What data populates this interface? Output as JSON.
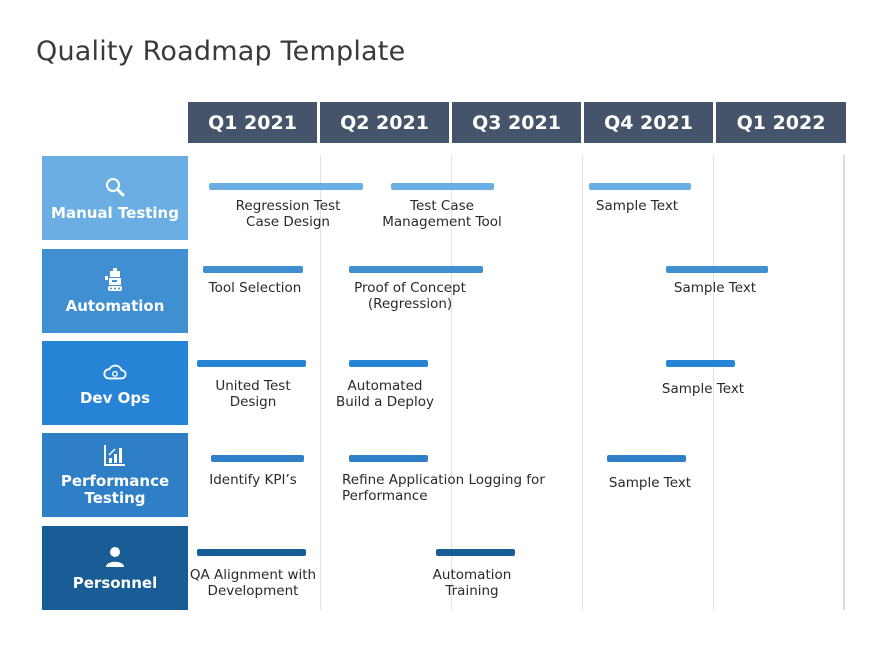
{
  "title": "Quality Roadmap Template",
  "quarters": [
    "Q1 2021",
    "Q2 2021",
    "Q3 2021",
    "Q4 2021",
    "Q1 2022"
  ],
  "colors": {
    "header_bg": "#46546b",
    "manual_testing": "#6aaee3",
    "automation": "#3f8fd2",
    "dev_ops": "#2683d6",
    "performance_testing": "#2f7fc7",
    "personnel": "#195d96"
  },
  "rows": [
    {
      "label": "Manual Testing",
      "icon": "search-icon",
      "items": [
        {
          "text": "Regression Test\nCase Design"
        },
        {
          "text": "Test Case\nManagement Tool"
        },
        {
          "text": "Sample Text"
        }
      ]
    },
    {
      "label": "Automation",
      "icon": "robot-icon",
      "items": [
        {
          "text": "Tool Selection"
        },
        {
          "text": "Proof of Concept\n(Regression)"
        },
        {
          "text": "Sample Text"
        }
      ]
    },
    {
      "label": "Dev Ops",
      "icon": "cloud-sync-icon",
      "items": [
        {
          "text": "United Test\nDesign"
        },
        {
          "text": "Automated\nBuild a Deploy"
        },
        {
          "text": "Sample Text"
        }
      ]
    },
    {
      "label": "Performance\nTesting",
      "icon": "bar-chart-icon",
      "items": [
        {
          "text": "Identify KPI’s"
        },
        {
          "text": "Refine Application Logging for\nPerformance"
        },
        {
          "text": "Sample Text"
        }
      ]
    },
    {
      "label": "Personnel",
      "icon": "user-icon",
      "items": [
        {
          "text": "QA Alignment with\nDevelopment"
        },
        {
          "text": "Automation\nTraining"
        }
      ]
    }
  ]
}
